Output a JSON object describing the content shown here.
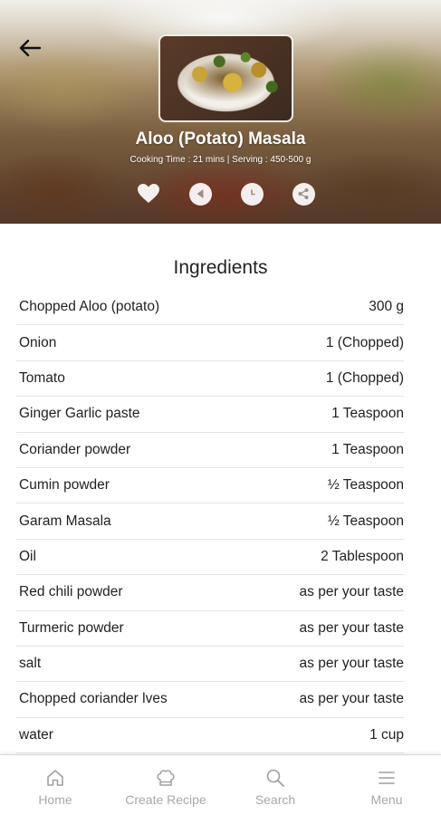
{
  "header": {
    "title": "Aloo (Potato) Masala",
    "meta": "Cooking Time : 21 mins | Serving : 450-500 g"
  },
  "actions": [
    "heart-icon",
    "play-icon",
    "clock-icon",
    "share-icon"
  ],
  "ingredients": {
    "title": "Ingredients",
    "items": [
      {
        "name": "Chopped Aloo (potato)",
        "qty": "300 g"
      },
      {
        "name": "Onion",
        "qty": "1 (Chopped)"
      },
      {
        "name": "Tomato",
        "qty": "1 (Chopped)"
      },
      {
        "name": "Ginger Garlic paste",
        "qty": "1 Teaspoon"
      },
      {
        "name": "Coriander powder",
        "qty": "1 Teaspoon"
      },
      {
        "name": "Cumin powder",
        "qty": "½ Teaspoon"
      },
      {
        "name": "Garam Masala",
        "qty": "½ Teaspoon"
      },
      {
        "name": "Oil",
        "qty": "2 Tablespoon"
      },
      {
        "name": "Red chili powder",
        "qty": "as per your taste"
      },
      {
        "name": "Turmeric powder",
        "qty": "as per your taste"
      },
      {
        "name": "salt",
        "qty": "as per your taste"
      },
      {
        "name": "Chopped coriander lves",
        "qty": "as per your taste"
      },
      {
        "name": "water",
        "qty": "1 cup"
      }
    ]
  },
  "nav": {
    "home": "Home",
    "create": "Create Recipe",
    "search": "Search",
    "menu": "Menu"
  },
  "colors": {
    "nav_label": "#a8a8a8",
    "divider": "#e4e4e4",
    "text": "#222222"
  }
}
